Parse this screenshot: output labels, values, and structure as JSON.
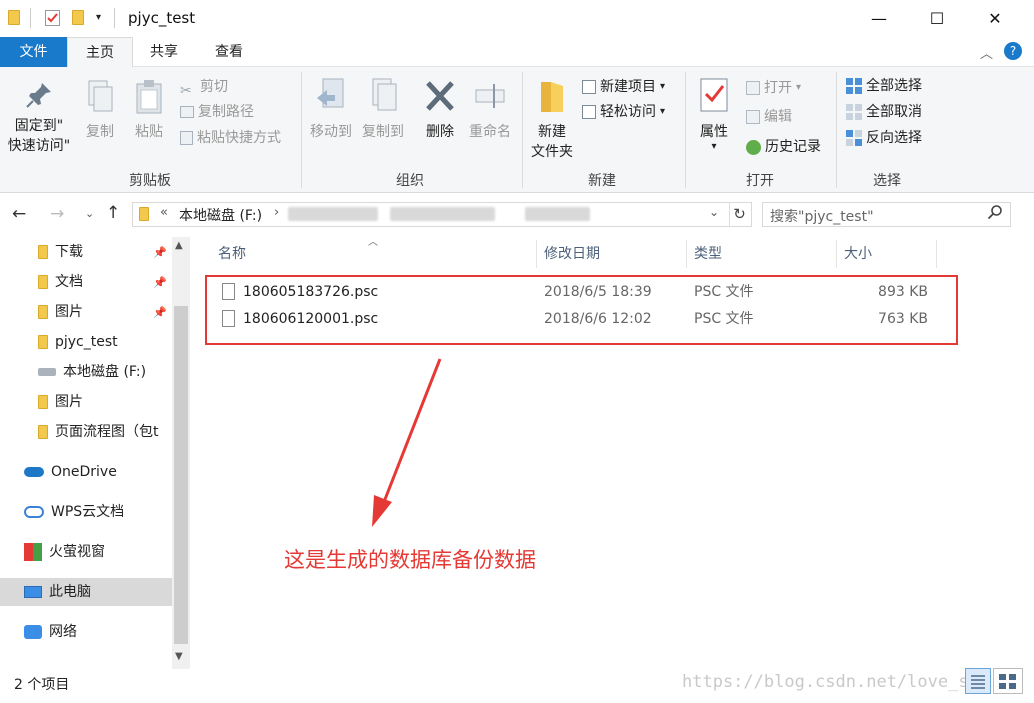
{
  "window": {
    "title": "pjyc_test",
    "minimize": "—",
    "maximize": "☐",
    "close": "✕"
  },
  "tabs": {
    "file": "文件",
    "home": "主页",
    "share": "共享",
    "view": "查看"
  },
  "ribbon": {
    "clipboard": {
      "pin_line1": "固定到\"",
      "pin_line2": "快速访问\"",
      "copy": "复制",
      "paste": "粘贴",
      "cut": "剪切",
      "copy_path": "复制路径",
      "paste_shortcut": "粘贴快捷方式",
      "group": "剪贴板"
    },
    "organize": {
      "move_to": "移动到",
      "copy_to": "复制到",
      "delete": "删除",
      "rename": "重命名",
      "group": "组织"
    },
    "new": {
      "new_folder_line1": "新建",
      "new_folder_line2": "文件夹",
      "new_item": "新建项目",
      "easy_access": "轻松访问",
      "group": "新建"
    },
    "open": {
      "properties": "属性",
      "open": "打开",
      "edit": "编辑",
      "history": "历史记录",
      "group": "打开"
    },
    "select": {
      "select_all": "全部选择",
      "select_none": "全部取消",
      "invert": "反向选择",
      "group": "选择"
    }
  },
  "address": {
    "prefix": "«",
    "drive": "本地磁盘 (F:)",
    "sep": "›",
    "search_placeholder": "搜索\"pjyc_test\""
  },
  "sidebar": {
    "items": [
      {
        "label": "下载",
        "pinned": true
      },
      {
        "label": "文档",
        "pinned": true
      },
      {
        "label": "图片",
        "pinned": true
      },
      {
        "label": "pjyc_test"
      },
      {
        "label": "本地磁盘 (F:)"
      },
      {
        "label": "图片"
      },
      {
        "label": "页面流程图（包t"
      },
      {
        "label": "OneDrive"
      },
      {
        "label": "WPS云文档"
      },
      {
        "label": "火萤视窗"
      },
      {
        "label": "此电脑"
      },
      {
        "label": "网络"
      }
    ]
  },
  "columns": {
    "name": "名称",
    "modified": "修改日期",
    "type": "类型",
    "size": "大小"
  },
  "files": [
    {
      "name": "180605183726.psc",
      "modified": "2018/6/5 18:39",
      "type": "PSC 文件",
      "size": "893 KB"
    },
    {
      "name": "180606120001.psc",
      "modified": "2018/6/6 12:02",
      "type": "PSC 文件",
      "size": "763 KB"
    }
  ],
  "annotation": "这是生成的数据库备份数据",
  "status": {
    "count": "2 个项目"
  },
  "watermark": "https://blog.csdn.net/love_s",
  "colors": {
    "accent": "#1979ca",
    "annotation": "#e53935",
    "selection": "#cce8ff"
  }
}
